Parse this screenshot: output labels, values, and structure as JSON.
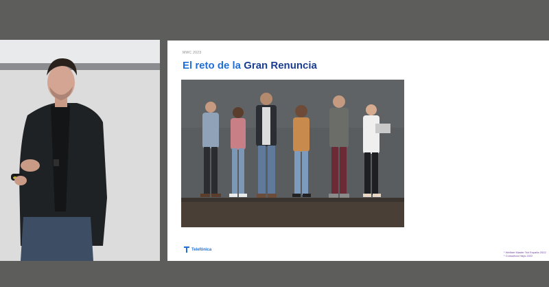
{
  "slide": {
    "tag": "MWC 2023",
    "title_part1": "El reto de la",
    "title_part2": "Gran Renuncia",
    "logo_text": "Telefónica",
    "footnotes": [
      "* Welfare Master Tsh España 2022",
      "* Consultora Hays 2022"
    ]
  },
  "colors": {
    "title": "#1a3d8f",
    "accent": "#1f6fd6",
    "footnote": "#6c3ea3",
    "background": "#5d5e5c"
  },
  "icons": {
    "logo": "telefonica-t-icon"
  }
}
